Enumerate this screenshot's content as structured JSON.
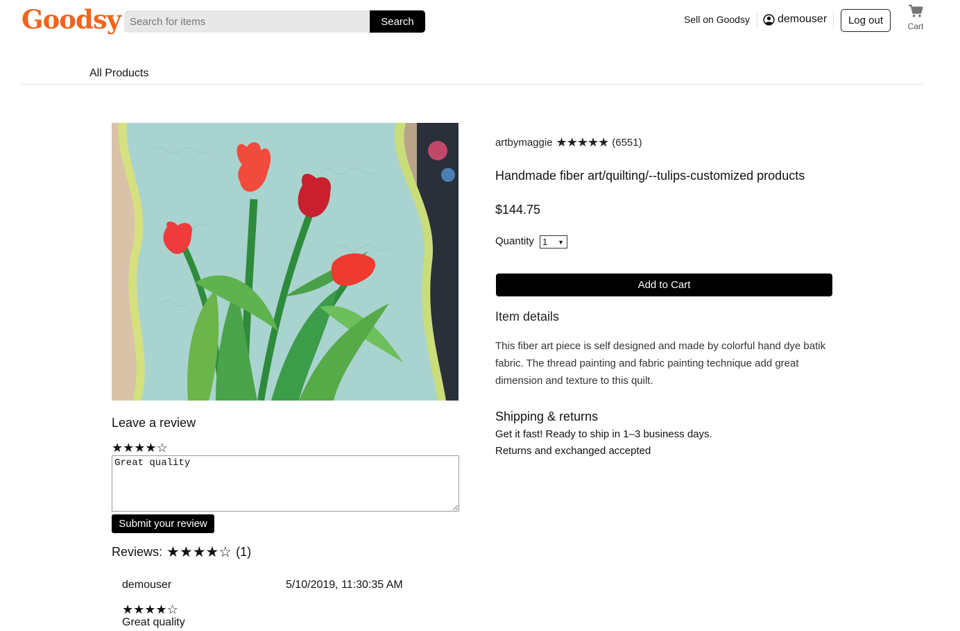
{
  "header": {
    "logo": "Goodsy",
    "search": {
      "placeholder": "Search for items",
      "value": "",
      "button_label": "Search"
    },
    "sell_link": "Sell on Goodsy",
    "username": "demouser",
    "logout_label": "Log out",
    "cart_label": "Cart"
  },
  "nav": {
    "category": "All Products"
  },
  "product": {
    "shop": {
      "name": "artbymaggie",
      "rating": 5,
      "rating_count": "(6551)"
    },
    "title": "Handmade fiber art/quilting/--tulips-customized products",
    "price": "$144.75",
    "quantity_label": "Quantity",
    "quantity_value": "1",
    "add_to_cart_label": "Add to Cart",
    "details_heading": "Item details",
    "details_text": "This fiber art piece is self designed and made by colorful hand dye batik fabric. The thread painting and fabric painting technique add great dimension and texture to this quilt.",
    "shipping_heading": "Shipping & returns",
    "shipping_line1": "Get it fast! Ready to ship in 1–3 business days.",
    "shipping_line2": "Returns and exchanged accepted"
  },
  "review_form": {
    "heading": "Leave a review",
    "selected_rating": 4,
    "max_rating": 5,
    "text_value": "Great quality",
    "submit_label": "Submit your review"
  },
  "reviews": {
    "label": "Reviews:",
    "average_rating": 4,
    "count": "(1)",
    "items": [
      {
        "user": "demouser",
        "date": "5/10/2019, 11:30:35 AM",
        "rating": 4,
        "text": "Great quality"
      }
    ]
  },
  "icons": {
    "user": "user-circle-icon",
    "cart": "shopping-cart-icon",
    "star": "star-icon"
  },
  "colors": {
    "brand": "#f1641e",
    "button": "#000000"
  }
}
